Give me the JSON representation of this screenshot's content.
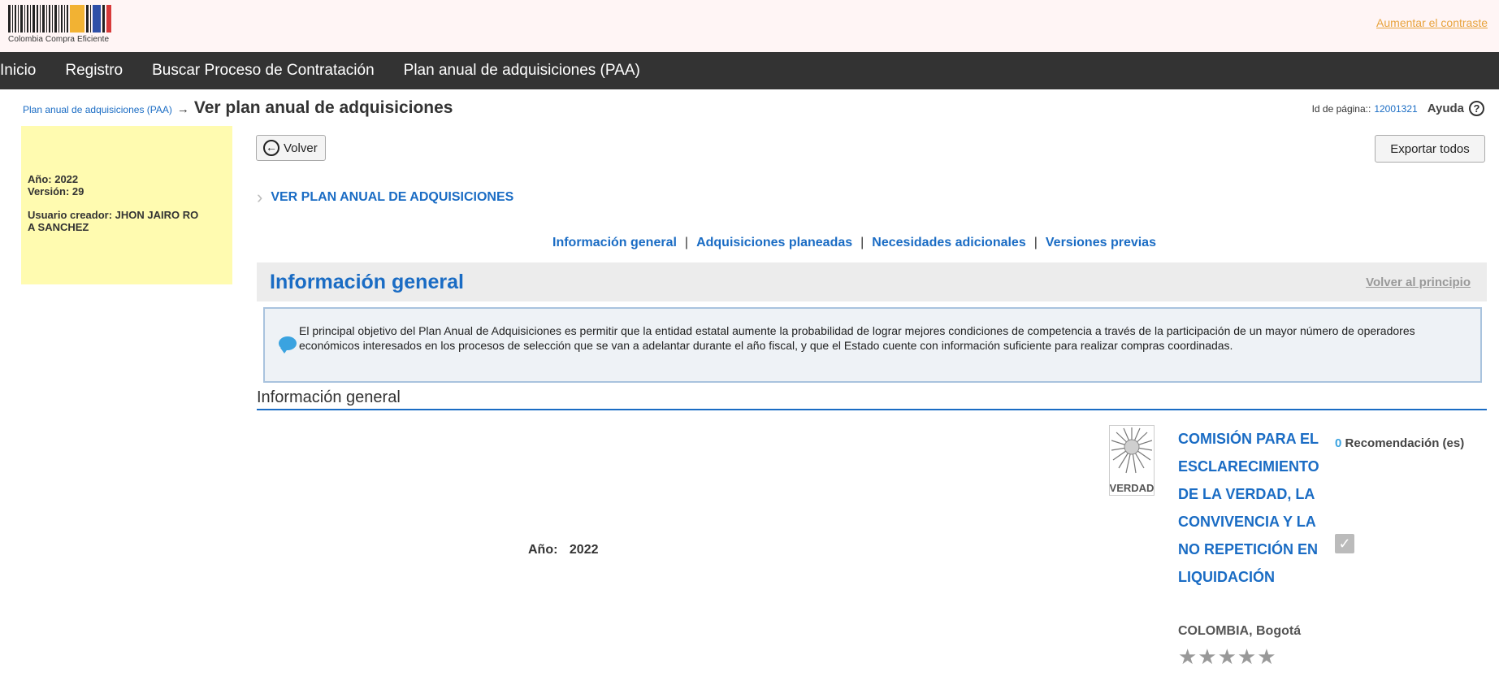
{
  "header": {
    "logo_text": "Colombia Compra Eficiente",
    "contrast_link": "Aumentar el contraste"
  },
  "nav": {
    "items": [
      "Inicio",
      "Registro",
      "Buscar Proceso de Contratación",
      "Plan anual de adquisiciones (PAA)"
    ]
  },
  "breadcrumb": {
    "parent": "Plan anual de adquisiciones (PAA)",
    "arrow": "→",
    "title": "Ver plan anual de adquisiciones"
  },
  "page_meta": {
    "id_label": "Id de página::",
    "id_value": "12001321",
    "help_label": "Ayuda",
    "help_icon": "question-circle-icon"
  },
  "side_panel": {
    "year": "Año: 2022",
    "version": "Versión: 29",
    "creator_line1": "Usuario creador: JHON JAIRO RO",
    "creator_line2": "A SANCHEZ"
  },
  "actions": {
    "back_label": "Volver",
    "export_label": "Exportar todos"
  },
  "section": {
    "toggle_label": "VER PLAN ANUAL DE ADQUISICIONES"
  },
  "tabs": [
    "Información general",
    "Adquisiciones planeadas",
    "Necesidades adicionales",
    "Versiones previas"
  ],
  "info_header": {
    "title": "Información general",
    "back_to_top": "Volver al principio"
  },
  "notice": {
    "text": "El principal objetivo del Plan Anual de Adquisiciones es permitir que la entidad estatal aumente la probabilidad de lograr mejores condiciones de competencia a través de la participación de un mayor número de operadores económicos interesados en los procesos de selección que se van a adelantar durante el año fiscal, y que el Estado cuente con información suficiente para realizar compras coordinadas."
  },
  "subheading": "Información general",
  "year_field": {
    "label": "Año:",
    "value": "2022"
  },
  "entity": {
    "logo_label": "VERDAD",
    "name": "COMISIÓN PARA EL ESCLARECIMIENTO DE LA VERDAD, LA CONVIVENCIA Y LA NO REPETICIÓN EN LIQUIDACIÓN",
    "recommendations_count": "0",
    "recommendations_label": "Recomendación (es)",
    "location": "COLOMBIA, Bogotá",
    "rating_stars": "★★★★★",
    "rating": 0
  },
  "colors": {
    "link_blue": "#1a6cc4",
    "nav_bg": "#333333",
    "side_panel_bg": "#fffbb0",
    "contrast_link": "#e8a33d"
  }
}
